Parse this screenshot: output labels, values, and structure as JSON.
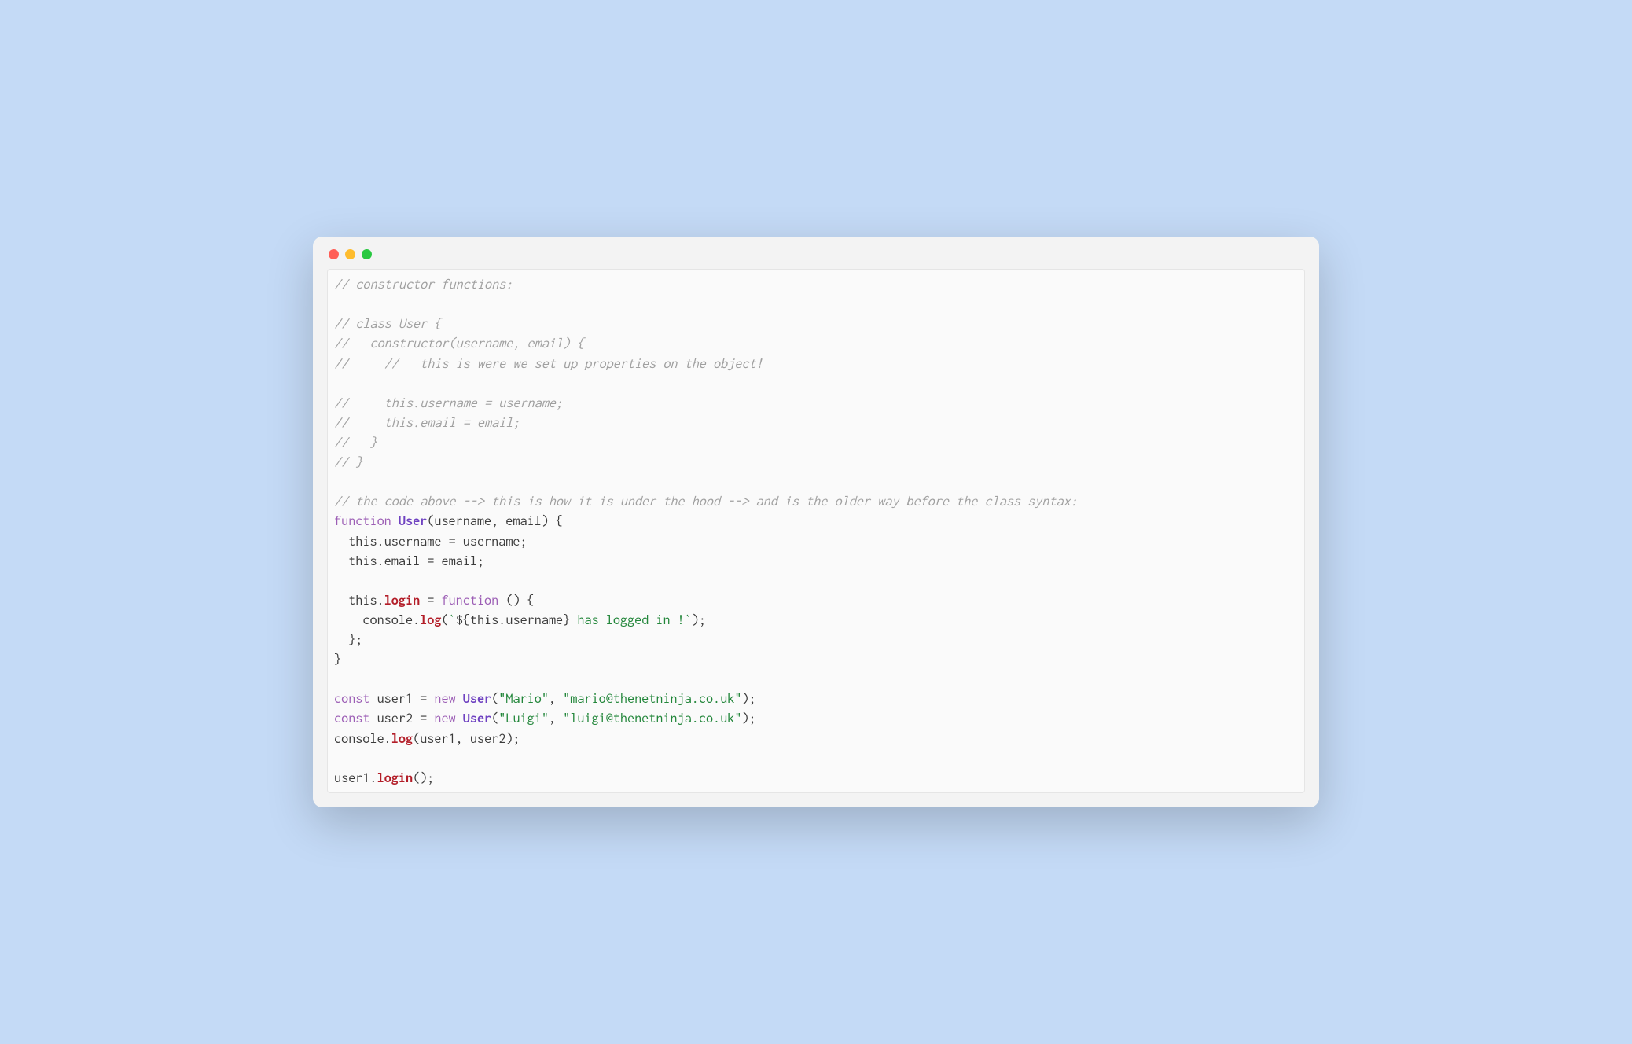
{
  "code": {
    "lines": [
      {
        "type": "comment",
        "text": "// constructor functions:"
      },
      {
        "type": "blank",
        "text": ""
      },
      {
        "type": "comment",
        "text": "// class User {"
      },
      {
        "type": "comment",
        "text": "//   constructor(username, email) {"
      },
      {
        "type": "comment",
        "text": "//     //   this is were we set up properties on the object!"
      },
      {
        "type": "blank",
        "text": ""
      },
      {
        "type": "comment",
        "text": "//     this.username = username;"
      },
      {
        "type": "comment",
        "text": "//     this.email = email;"
      },
      {
        "type": "comment",
        "text": "//   }"
      },
      {
        "type": "comment",
        "text": "// }"
      },
      {
        "type": "blank",
        "text": ""
      },
      {
        "type": "comment",
        "text": "// the code above --> this is how it is under the hood --> and is the older way before the class syntax:"
      },
      {
        "type": "fn-decl",
        "tokens": {
          "kw": "function",
          "name": "User",
          "params": "(username, email)",
          "brace": " {"
        }
      },
      {
        "type": "assign",
        "tokens": {
          "indent": "  ",
          "this": "this",
          "dot": ".",
          "prop": "username",
          "eq": " = ",
          "val": "username",
          "semi": ";"
        }
      },
      {
        "type": "assign",
        "tokens": {
          "indent": "  ",
          "this": "this",
          "dot": ".",
          "prop": "email",
          "eq": " = ",
          "val": "email",
          "semi": ";"
        }
      },
      {
        "type": "blank",
        "text": ""
      },
      {
        "type": "method-assign",
        "tokens": {
          "indent": "  ",
          "this": "this",
          "dot": ".",
          "method": "login",
          "eq": " = ",
          "kw": "function",
          "params": " ()",
          "brace": " {"
        }
      },
      {
        "type": "console-log-template",
        "tokens": {
          "indent": "    ",
          "obj": "console",
          "dot": ".",
          "method": "log",
          "open": "(",
          "tick1": "`",
          "expr_open": "${",
          "this": "this",
          "dot2": ".",
          "prop": "username",
          "expr_close": "}",
          "rest": " has logged in !",
          "tick2": "`",
          "close": ")",
          "semi": ";"
        }
      },
      {
        "type": "close-brace",
        "tokens": {
          "indent": "  ",
          "brace": "};"
        }
      },
      {
        "type": "close-brace",
        "tokens": {
          "indent": "",
          "brace": "}"
        }
      },
      {
        "type": "blank",
        "text": ""
      },
      {
        "type": "const-new",
        "tokens": {
          "kw": "const",
          "name": " user1",
          "eq": " = ",
          "new": "new",
          "ctor": " User",
          "open": "(",
          "arg1": "\"Mario\"",
          "comma": ", ",
          "arg2": "\"mario@thenetninja.co.uk\"",
          "close": ")",
          "semi": ";"
        }
      },
      {
        "type": "const-new",
        "tokens": {
          "kw": "const",
          "name": " user2",
          "eq": " = ",
          "new": "new",
          "ctor": " User",
          "open": "(",
          "arg1": "\"Luigi\"",
          "comma": ", ",
          "arg2": "\"luigi@thenetninja.co.uk\"",
          "close": ")",
          "semi": ";"
        }
      },
      {
        "type": "console-log-vars",
        "tokens": {
          "obj": "console",
          "dot": ".",
          "method": "log",
          "open": "(",
          "arg1": "user1",
          "comma": ", ",
          "arg2": "user2",
          "close": ")",
          "semi": ";"
        }
      },
      {
        "type": "blank",
        "text": ""
      },
      {
        "type": "method-call",
        "tokens": {
          "obj": "user1",
          "dot": ".",
          "method": "login",
          "open": "(",
          "close": ")",
          "semi": ";"
        }
      }
    ]
  }
}
